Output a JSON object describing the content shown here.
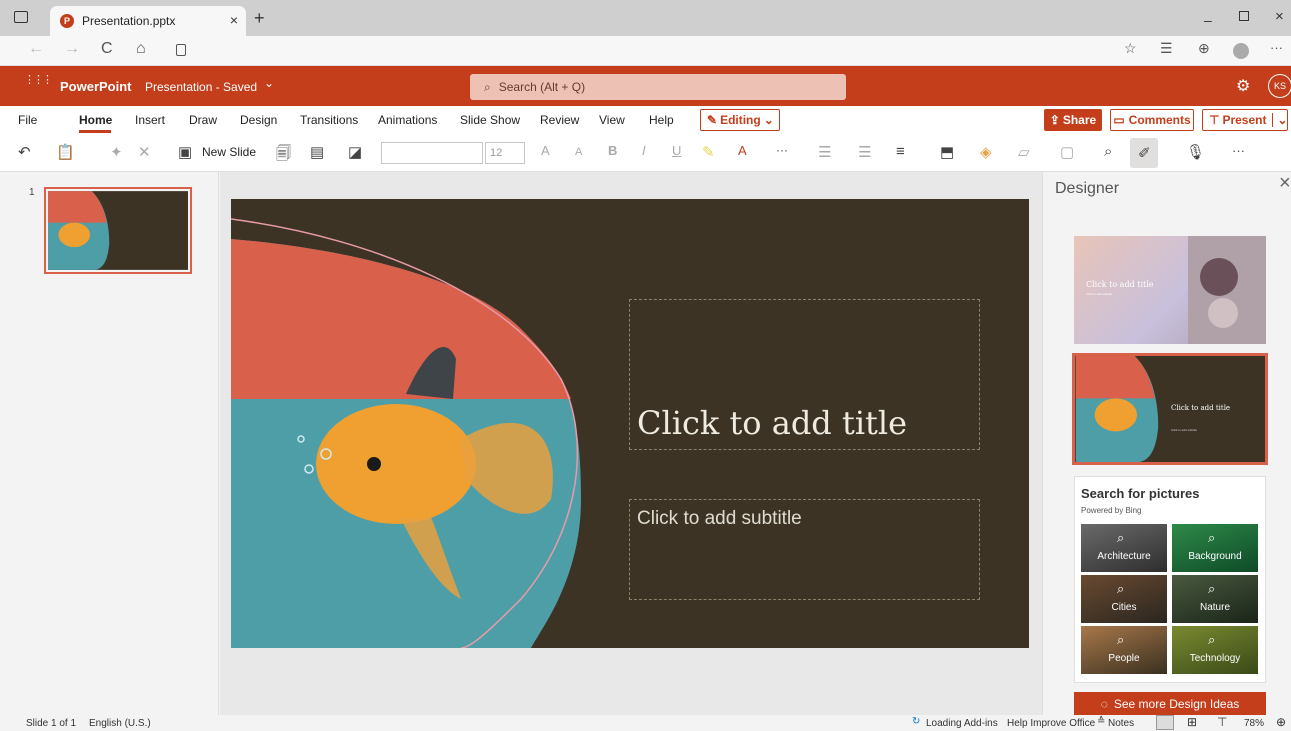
{
  "browser": {
    "tab_title": "Presentation.pptx",
    "tab_close": "×",
    "new_tab": "+",
    "back": "←",
    "forward": "→",
    "refresh": "C",
    "home": "⌂",
    "lock": "🔒"
  },
  "appbar": {
    "launcher": "⋮⋮⋮",
    "app_name": "PowerPoint",
    "doc_status": "Presentation - Saved",
    "doc_chevron": "⌄",
    "search_placeholder": "Search (Alt + Q)",
    "avatar": "KS"
  },
  "menu": {
    "items": [
      "File",
      "Home",
      "Insert",
      "Draw",
      "Design",
      "Transitions",
      "Animations",
      "Slide Show",
      "Review",
      "View",
      "Help"
    ],
    "editing": "Editing",
    "share": "Share",
    "comments": "Comments",
    "present": "Present"
  },
  "ribbon": {
    "new_slide": "New Slide",
    "font_size": "12",
    "font_buttons": [
      "A",
      "A",
      "B",
      "I",
      "U"
    ],
    "more": "···"
  },
  "slides": {
    "number": "1"
  },
  "slide": {
    "title_placeholder": "Click to add title",
    "subtitle_placeholder": "Click to add subtitle"
  },
  "designer": {
    "title": "Designer",
    "close": "×",
    "idea1_title": "Click to add title",
    "idea1_sub": "Click to add subtitle",
    "idea2_title": "Click to add title",
    "idea2_sub": "Click to add subtitle",
    "search_heading": "Search for pictures",
    "powered": "Powered by Bing",
    "categories": [
      "Architecture",
      "Background",
      "Cities",
      "Nature",
      "People",
      "Technology"
    ],
    "more_button": "See more Design Ideas"
  },
  "status": {
    "slide_count": "Slide 1 of 1",
    "language": "English (U.S.)",
    "addins": "Loading Add-ins",
    "help": "Help Improve Office",
    "notes": "Notes",
    "zoom": "78%"
  },
  "colors": {
    "brand": "#c43e1c",
    "slide_bg": "#3c3324",
    "coral": "#d9604a",
    "water": "#4e9ea8"
  }
}
